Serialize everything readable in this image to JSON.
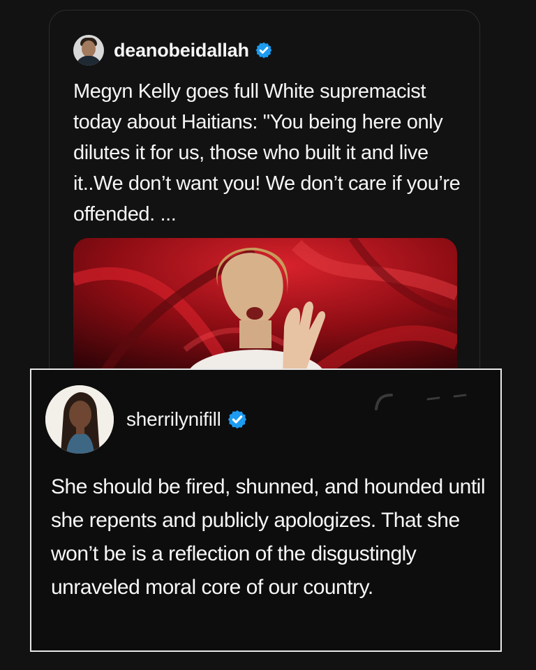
{
  "post": {
    "username": "deanobeidallah",
    "verified_icon": "verified-badge-icon",
    "avatar_icon": "user-avatar",
    "text": "Megyn Kelly goes full White supremacist today about Haitians: \"You being here only dilutes it for us, those who built it and live it..We don’t want you! We don’t care if you’re offended. ...",
    "media_icon": "video-thumbnail"
  },
  "reply": {
    "username": "sherrilynifill",
    "verified_icon": "verified-badge-icon",
    "avatar_icon": "user-avatar",
    "text": "She should be fired, shunned, and hounded until she repents and publicly apologizes. That she won’t be is a reflection of the disgustingly unraveled moral core of our country."
  },
  "colors": {
    "background": "#121212",
    "verified": "#1d9bf0",
    "media_red": "#b4121b"
  }
}
